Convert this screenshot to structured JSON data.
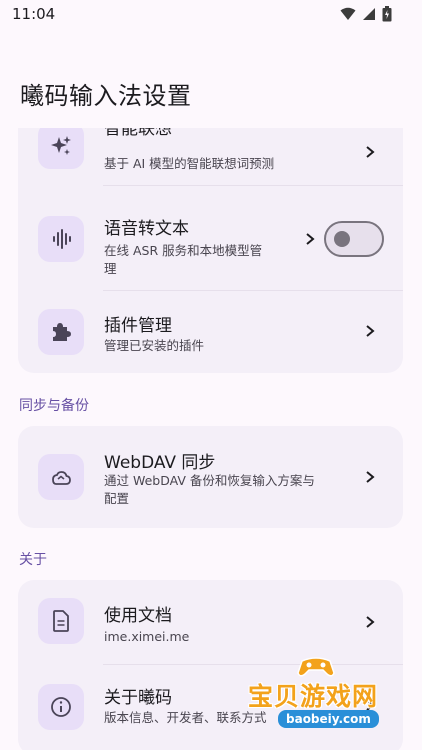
{
  "status_bar": {
    "time": "11:04"
  },
  "page": {
    "title": "曦码输入法设置"
  },
  "sections": {
    "top_card": {
      "items": [
        {
          "title": "智能联想",
          "subtitle": "基于 AI 模型的智能联想词预测",
          "icon": "sparkles-icon"
        },
        {
          "title": "语音转文本",
          "subtitle_line1": "在线 ASR 服务和本地模型管",
          "subtitle_line2": "理",
          "icon": "voice-wave-icon",
          "toggle_on": false
        },
        {
          "title": "插件管理",
          "subtitle": "管理已安装的插件",
          "icon": "puzzle-icon"
        }
      ]
    },
    "sync": {
      "header": "同步与备份",
      "items": [
        {
          "title": "WebDAV 同步",
          "subtitle_line1": "通过 WebDAV 备份和恢复输入方案与",
          "subtitle_line2": "配置",
          "icon": "cloud-sync-icon"
        }
      ]
    },
    "about": {
      "header": "关于",
      "items": [
        {
          "title": "使用文档",
          "subtitle": "ime.ximei.me",
          "icon": "document-icon"
        },
        {
          "title": "关于曦码",
          "subtitle": "版本信息、开发者、联系方式",
          "icon": "info-icon"
        }
      ]
    }
  },
  "watermark": {
    "text": "宝贝游戏网",
    "url": "baobeiy.com"
  },
  "colors": {
    "accent": "#6750a4",
    "icon_bg": "#e8def8",
    "card_bg": "#f4eff8",
    "page_bg": "#fdf8fd"
  }
}
